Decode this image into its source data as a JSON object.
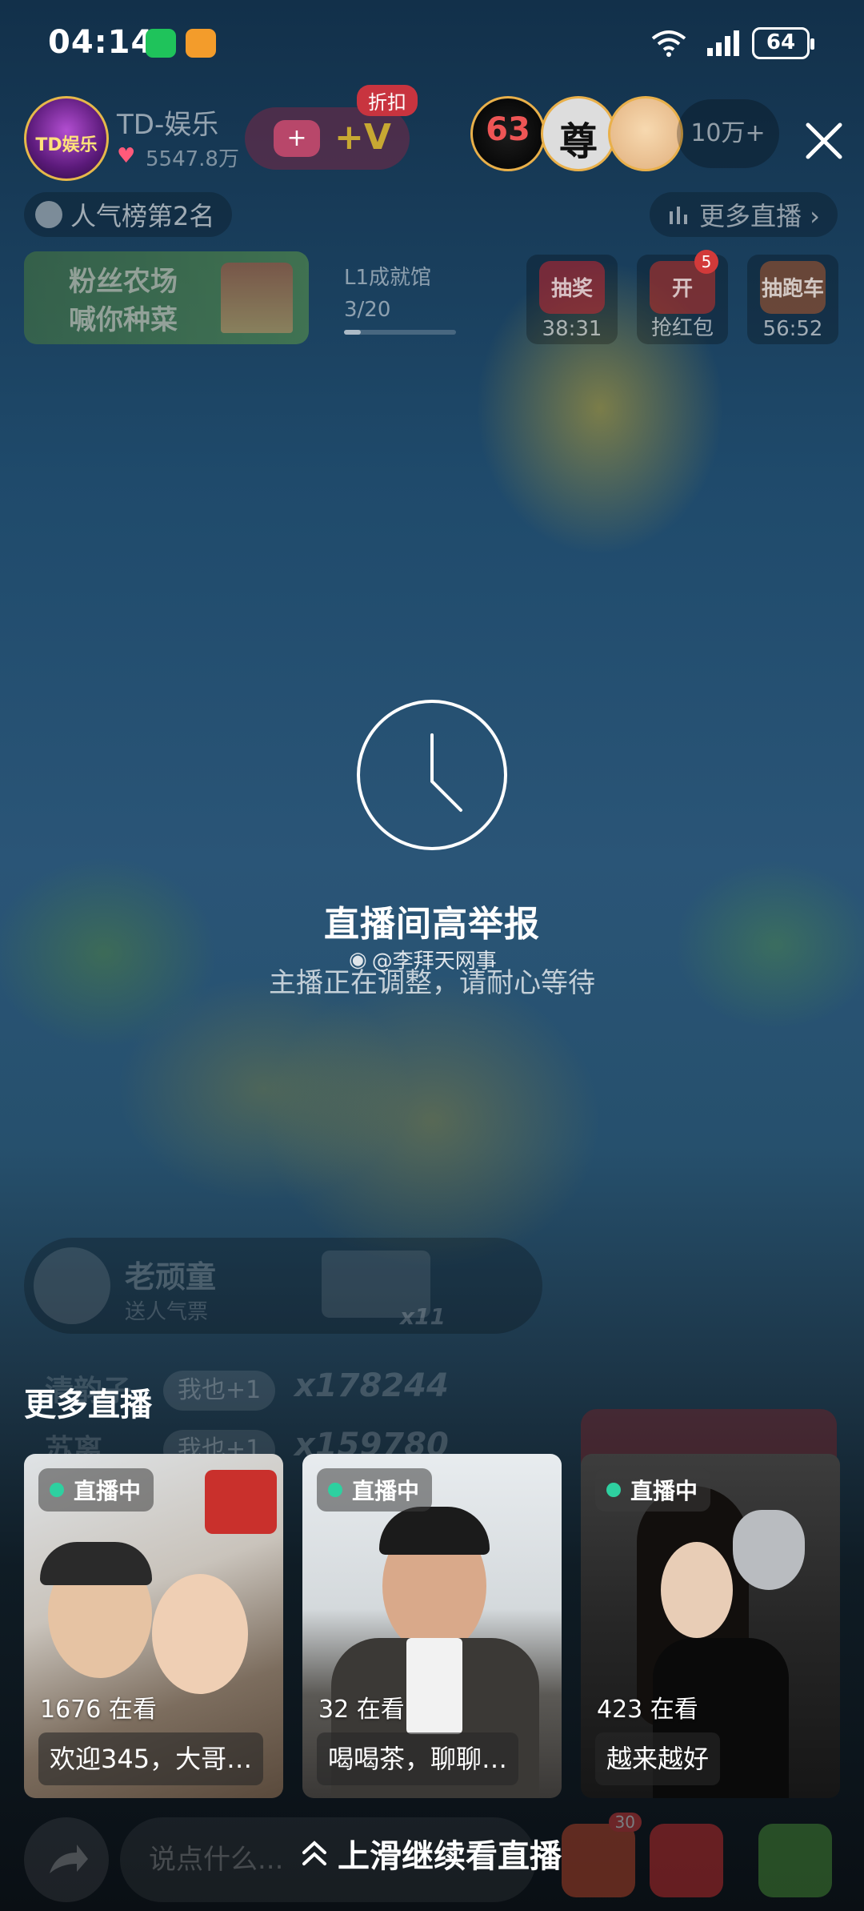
{
  "status_bar": {
    "time": "04:14",
    "battery": "64",
    "app_icons": [
      "wechat-icon",
      "game-controller-icon"
    ]
  },
  "stream_header": {
    "host_avatar_label": "TD娱乐",
    "host_name": "TD-娱乐",
    "host_likes": "5547.8万",
    "gift_plus_label": "+V",
    "discount_badge": "折扣",
    "viewer_avatar_1": "63",
    "viewer_avatar_2": "尊",
    "viewer_count": "10万+",
    "rank_label": "人气榜第2名",
    "more_live_label": "更多直播 ›"
  },
  "activity_row": {
    "farm_line1": "粉丝农场",
    "farm_line2": "喊你种菜",
    "achievement_title": "L1成就馆",
    "achievement_progress": "3/20",
    "achievement_fraction": 0.15,
    "tiles": [
      {
        "title": "抽奖",
        "label": "38:31"
      },
      {
        "title": "开",
        "label": "抢红包",
        "badge": "5"
      },
      {
        "title": "抽跑车",
        "label": "56:52"
      }
    ]
  },
  "notice": {
    "title": "直播间高举报",
    "subtitle": "主播正在调整，请耐心等待",
    "watermark": "@李拜天网事"
  },
  "faded_chat": {
    "user_name": "老顽童",
    "user_action": "送人气票",
    "gift_count": "x11",
    "combo_rows": [
      {
        "name": "清韵子",
        "button": "我也+1",
        "count": "x178244"
      },
      {
        "name": "苏离",
        "button": "我也+1",
        "count": "x159780"
      }
    ]
  },
  "more_live": {
    "title": "更多直播",
    "cards": [
      {
        "tag": "直播中",
        "viewers": "1676 在看",
        "caption": "欢迎345，大哥…"
      },
      {
        "tag": "直播中",
        "viewers": "32 在看",
        "caption": "喝喝茶，聊聊…"
      },
      {
        "tag": "直播中",
        "viewers": "423 在看",
        "caption": "越来越好"
      }
    ]
  },
  "bottom_bar": {
    "comment_placeholder": "说点什么...",
    "swipe_hint": "上滑继续看直播",
    "gift_badge": "30"
  },
  "colors": {
    "live_dot": "#2ed0a0",
    "discount_badge": "#c8343f",
    "avatar_border": "#e9b04a"
  }
}
